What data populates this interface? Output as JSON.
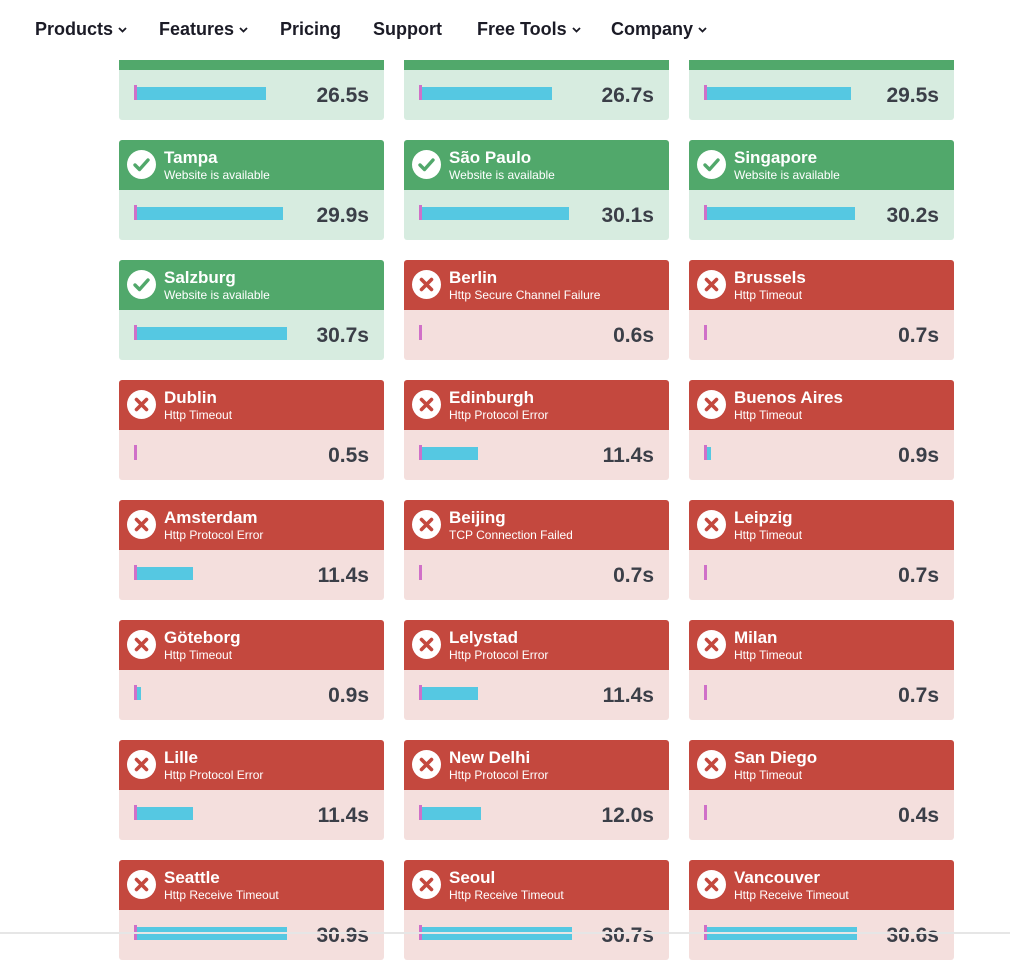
{
  "nav": {
    "items": [
      {
        "label": "Products",
        "dropdown": true
      },
      {
        "label": "Features",
        "dropdown": true
      },
      {
        "label": "Pricing",
        "dropdown": false
      },
      {
        "label": "Support",
        "dropdown": false
      },
      {
        "label": "Free Tools",
        "dropdown": true
      },
      {
        "label": "Company",
        "dropdown": true
      }
    ]
  },
  "colors": {
    "up_header": "#51a86b",
    "up_body": "#d7ece0",
    "down_header": "#c4483e",
    "down_body": "#f4dfdd",
    "bar": "#55c8e2",
    "marker": "#d070c8"
  },
  "bar_scale_max_seconds": 30.7,
  "rows": [
    [
      {
        "city": "",
        "message": "",
        "time": "26.5s",
        "seconds": 26.5,
        "status": "up"
      },
      {
        "city": "",
        "message": "",
        "time": "26.7s",
        "seconds": 26.7,
        "status": "up"
      },
      {
        "city": "",
        "message": "",
        "time": "29.5s",
        "seconds": 29.5,
        "status": "up"
      }
    ],
    [
      {
        "city": "Tampa",
        "message": "Website is available",
        "time": "29.9s",
        "seconds": 29.9,
        "status": "up"
      },
      {
        "city": "São Paulo",
        "message": "Website is available",
        "time": "30.1s",
        "seconds": 30.1,
        "status": "up"
      },
      {
        "city": "Singapore",
        "message": "Website is available",
        "time": "30.2s",
        "seconds": 30.2,
        "status": "up"
      }
    ],
    [
      {
        "city": "Salzburg",
        "message": "Website is available",
        "time": "30.7s",
        "seconds": 30.7,
        "status": "up"
      },
      {
        "city": "Berlin",
        "message": "Http Secure Channel Failure",
        "time": "0.6s",
        "seconds": 0.6,
        "status": "down"
      },
      {
        "city": "Brussels",
        "message": "Http Timeout",
        "time": "0.7s",
        "seconds": 0.7,
        "status": "down"
      }
    ],
    [
      {
        "city": "Dublin",
        "message": "Http Timeout",
        "time": "0.5s",
        "seconds": 0.5,
        "status": "down"
      },
      {
        "city": "Edinburgh",
        "message": "Http Protocol Error",
        "time": "11.4s",
        "seconds": 11.4,
        "status": "down"
      },
      {
        "city": "Buenos Aires",
        "message": "Http Timeout",
        "time": "0.9s",
        "seconds": 0.9,
        "status": "down"
      }
    ],
    [
      {
        "city": "Amsterdam",
        "message": "Http Protocol Error",
        "time": "11.4s",
        "seconds": 11.4,
        "status": "down"
      },
      {
        "city": "Beijing",
        "message": "TCP Connection Failed",
        "time": "0.7s",
        "seconds": 0.7,
        "status": "down"
      },
      {
        "city": "Leipzig",
        "message": "Http Timeout",
        "time": "0.7s",
        "seconds": 0.7,
        "status": "down"
      }
    ],
    [
      {
        "city": "Göteborg",
        "message": "Http Timeout",
        "time": "0.9s",
        "seconds": 0.9,
        "status": "down"
      },
      {
        "city": "Lelystad",
        "message": "Http Protocol Error",
        "time": "11.4s",
        "seconds": 11.4,
        "status": "down"
      },
      {
        "city": "Milan",
        "message": "Http Timeout",
        "time": "0.7s",
        "seconds": 0.7,
        "status": "down"
      }
    ],
    [
      {
        "city": "Lille",
        "message": "Http Protocol Error",
        "time": "11.4s",
        "seconds": 11.4,
        "status": "down"
      },
      {
        "city": "New Delhi",
        "message": "Http Protocol Error",
        "time": "12.0s",
        "seconds": 12.0,
        "status": "down"
      },
      {
        "city": "San Diego",
        "message": "Http Timeout",
        "time": "0.4s",
        "seconds": 0.4,
        "status": "down"
      }
    ],
    [
      {
        "city": "Seattle",
        "message": "Http Receive Timeout",
        "time": "30.9s",
        "seconds": 30.9,
        "status": "down"
      },
      {
        "city": "Seoul",
        "message": "Http Receive Timeout",
        "time": "30.7s",
        "seconds": 30.7,
        "status": "down"
      },
      {
        "city": "Vancouver",
        "message": "Http Receive Timeout",
        "time": "30.6s",
        "seconds": 30.6,
        "status": "down"
      }
    ]
  ]
}
